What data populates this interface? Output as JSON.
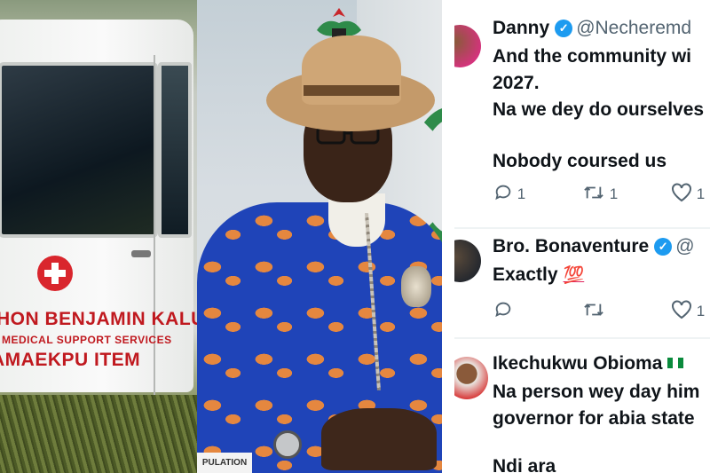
{
  "ambulance": {
    "line1": "HON BENJAMIN KALU",
    "line2": "MEDICAL SUPPORT SERVICES",
    "line3": "AMAEKPU ITEM"
  },
  "portrait": {
    "sign_text": "PULATION"
  },
  "colors": {
    "verified": "#1d9bf0",
    "text": "#0f1419",
    "muted": "#536471",
    "ambulance_red": "#c0191f",
    "shirt_blue": "#1f44b8"
  },
  "tweets": [
    {
      "name": "Danny",
      "handle": "@Necheremd",
      "verified": true,
      "lines": [
        "And the community wi",
        "2027.",
        "Na we dey do ourselves",
        "",
        "Nobody coursed us"
      ],
      "replies": "1",
      "retweets": "1",
      "likes": "1"
    },
    {
      "name": "Bro. Bonaventure",
      "handle": "@",
      "verified": true,
      "lines": [
        "Exactly"
      ],
      "emoji": "💯",
      "replies": "",
      "retweets": "",
      "likes": "1"
    },
    {
      "name": "Ikechukwu Obioma",
      "handle": "",
      "verified": false,
      "lines": [
        "Na person wey day him",
        "governor for abia state",
        "",
        "Ndi ara"
      ]
    }
  ],
  "icons": [
    "reply-icon",
    "retweet-icon",
    "like-icon",
    "verified-badge-icon",
    "nigeria-flag-icon",
    "medical-cross-icon"
  ]
}
